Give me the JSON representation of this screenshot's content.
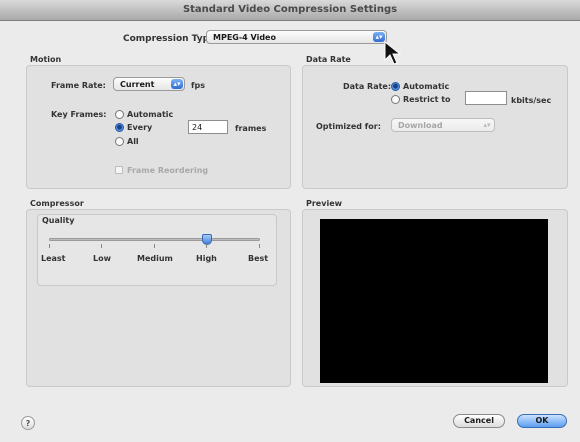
{
  "window": {
    "title": "Standard Video Compression Settings"
  },
  "compression": {
    "label": "Compression Type:",
    "value": "MPEG-4 Video"
  },
  "motion": {
    "title": "Motion",
    "frame_rate_label": "Frame Rate:",
    "frame_rate_value": "Current",
    "frame_rate_unit": "fps",
    "key_frames_label": "Key Frames:",
    "key_automatic": "Automatic",
    "key_every": "Every",
    "key_every_value": "24",
    "key_every_unit": "frames",
    "key_all": "All",
    "frame_reordering": "Frame Reordering"
  },
  "data_rate": {
    "title": "Data Rate",
    "label": "Data Rate:",
    "automatic": "Automatic",
    "restrict": "Restrict to",
    "restrict_value": "",
    "unit": "kbits/sec",
    "optimized_label": "Optimized for:",
    "optimized_value": "Download"
  },
  "compressor": {
    "title": "Compressor",
    "quality_label": "Quality",
    "quality_level": 0.75,
    "ticks": [
      "Least",
      "Low",
      "Medium",
      "High",
      "Best"
    ]
  },
  "preview": {
    "title": "Preview"
  },
  "buttons": {
    "help": "?",
    "cancel": "Cancel",
    "ok": "OK"
  }
}
